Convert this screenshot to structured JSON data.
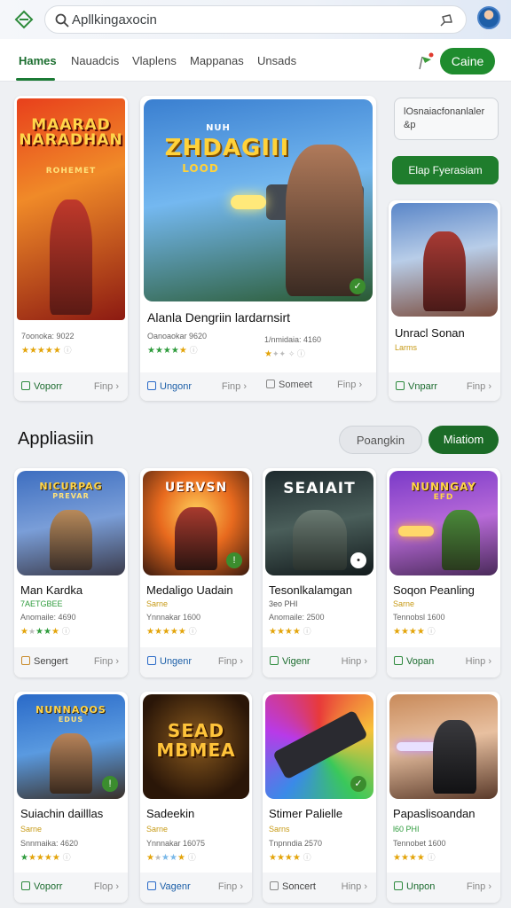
{
  "search": {
    "text": "Apllkingaxocin"
  },
  "nav": {
    "tabs": [
      {
        "label": "Hames"
      },
      {
        "label": "Nauadcis"
      },
      {
        "label": "Vlaplens"
      },
      {
        "label": "Mappanas"
      },
      {
        "label": "Unsads"
      }
    ],
    "cta_label": "Caine"
  },
  "featured": [
    {
      "art_text": "MAARAD NARADHAN",
      "art_sub": "ROHEMET",
      "meta": "7oonoka: 9022",
      "foot_left": "Voporr",
      "foot_right": "Finp ›"
    },
    {
      "art_text": "ZHDAGIII",
      "art_sub": "LOOD",
      "art_top": "NUH",
      "name": "Alanla Dengriin lardarnsirt",
      "meta": "Oanoaokar 9620",
      "foot_left": "Ungonr",
      "foot_right": "Finp ›"
    },
    {
      "name": "",
      "meta": "1/nmidaia: 4160",
      "foot_left": "Someet",
      "foot_right": "Finp ›"
    },
    {
      "name": "Unracl Sonan",
      "sub": "Larms",
      "foot_left": "Vnparr",
      "foot_right": "Finp ›"
    }
  ],
  "side": {
    "info_text": "lOsnaiacfonanlaler &p",
    "button_label": "Elap Fyerasiam"
  },
  "section": {
    "title": "Appliasiin",
    "pill_light": "Poangkin",
    "pill_dark": "Miatiom"
  },
  "grid": [
    {
      "art_text": "NICURPAG",
      "art_sub": "PREVAR",
      "name": "Man Kardka",
      "sub": "7AETGBEE",
      "meta": "Anomaile: 4690",
      "foot_left": "Sengert",
      "foot_right": "Finp ›"
    },
    {
      "art_text": "UERVSN",
      "name": "Medaligo Uadain",
      "sub": "Sarne",
      "meta": "Ynnnakar 1600",
      "foot_left": "Ungenr",
      "foot_right": "Finp ›"
    },
    {
      "art_text": "SEAIAIT",
      "name": "Tesonlkalamgan",
      "sub": "3eo PHI",
      "meta": "Anomaile: 2500",
      "foot_left": "Vigenr",
      "foot_right": "Hinp ›"
    },
    {
      "art_text": "NUNNGAY",
      "art_sub": "EFD",
      "name": "Soqon Peanling",
      "sub": "Sarne",
      "meta": "Tennobsl 1600",
      "foot_left": "Vopan",
      "foot_right": "Hinp ›"
    },
    {
      "art_text": "NUNNAQOS",
      "art_sub": "EDUS",
      "name": "Suiachin dailllas",
      "sub": "Sarne",
      "meta": "Snnmaika: 4620",
      "foot_left": "Voporr",
      "foot_right": "Flop ›"
    },
    {
      "art_text": "SEAD MBMEA",
      "name": "Sadeekin",
      "sub": "Sarne",
      "meta": "Ynnnakar 16075",
      "foot_left": "Vagenr",
      "foot_right": "Finp ›"
    },
    {
      "name": "Stimer Palielle",
      "sub": "Sarns",
      "meta": "Tnpnndia 2570",
      "foot_left": "Soncert",
      "foot_right": "Hinp ›"
    },
    {
      "name": "Papaslisoandan",
      "sub": "l60 PHI",
      "meta": "Tennobet 1600",
      "foot_left": "Unpon",
      "foot_right": "Finp ›"
    }
  ],
  "colors": {
    "brand_green": "#1f8c2e",
    "dark_green": "#1b6b27",
    "star_gold": "#e3a40a"
  }
}
